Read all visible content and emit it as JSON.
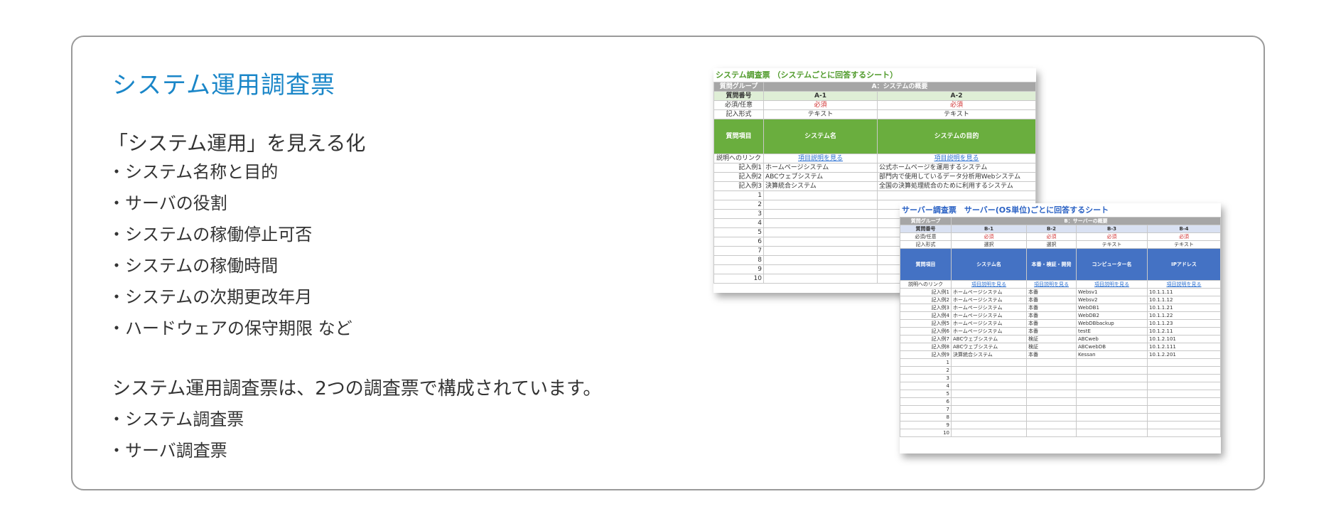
{
  "title": "システム運用調査票",
  "subtitle": "「システム運用」を見える化",
  "features": [
    "システム名称と目的",
    "サーバの役割",
    "システムの稼働停止可否",
    "システムの稼働時間",
    "システムの次期更改年月",
    "ハードウェアの保守期限 など"
  ],
  "description": "システム運用調査票は、2つの調査票で構成されています。",
  "sheets_list": [
    "システム調査票",
    "サーバ調査票"
  ],
  "system_sheet": {
    "title": "システム調査票 （システムごとに回答するシート）",
    "group_label": "質問グループ",
    "group_value": "A：システムの概要",
    "qno_label": "質問番号",
    "qnos": [
      "A-1",
      "A-2"
    ],
    "req_label": "必須/任意",
    "req_values": [
      "必須",
      "必須"
    ],
    "fmt_label": "記入形式",
    "fmt_values": [
      "テキスト",
      "テキスト"
    ],
    "item_label": "質問項目",
    "items": [
      "システム名",
      "システムの目的"
    ],
    "link_label": "説明へのリンク",
    "link_text": "項目説明を見る",
    "examples": [
      {
        "label": "記入例1",
        "values": [
          "ホームページシステム",
          "公式ホームページを運用するシステム"
        ]
      },
      {
        "label": "記入例2",
        "values": [
          "ABCウェブシステム",
          "部門内で使用しているデータ分析用Webシステム"
        ]
      },
      {
        "label": "記入例3",
        "values": [
          "決算統合システム",
          "全国の決算処理統合のために利用するシステム"
        ]
      }
    ],
    "rows": [
      "1",
      "2",
      "3",
      "4",
      "5",
      "6",
      "7",
      "8",
      "9",
      "10"
    ]
  },
  "server_sheet": {
    "title": "サーバー調査票　サーバー(OS単位)ごとに回答するシート",
    "group_label": "質問グループ",
    "group_value": "B：サーバーの概要",
    "qno_label": "質問番号",
    "qnos": [
      "B-1",
      "B-2",
      "B-3",
      "B-4"
    ],
    "req_label": "必須/任意",
    "req_values": [
      "必須",
      "必須",
      "必須",
      "必須"
    ],
    "fmt_label": "記入形式",
    "fmt_values": [
      "選択",
      "選択",
      "テキスト",
      "テキスト"
    ],
    "item_label": "質問項目",
    "items": [
      "システム名",
      "本番・検証・開発",
      "コンピューター名",
      "IPアドレス"
    ],
    "link_label": "説明へのリンク",
    "link_text": "項目説明を見る",
    "examples": [
      {
        "label": "記入例1",
        "values": [
          "ホームページシステム",
          "本番",
          "Websv1",
          "10.1.1.11"
        ]
      },
      {
        "label": "記入例2",
        "values": [
          "ホームページシステム",
          "本番",
          "Websv2",
          "10.1.1.12"
        ]
      },
      {
        "label": "記入例3",
        "values": [
          "ホームページシステム",
          "本番",
          "WebDB1",
          "10.1.1.21"
        ]
      },
      {
        "label": "記入例4",
        "values": [
          "ホームページシステム",
          "本番",
          "WebDB2",
          "10.1.1.22"
        ]
      },
      {
        "label": "記入例5",
        "values": [
          "ホームページシステム",
          "本番",
          "WebDBbackup",
          "10.1.1.23"
        ]
      },
      {
        "label": "記入例6",
        "values": [
          "ホームページシステム",
          "本番",
          "testE",
          "10.1.2.11"
        ]
      },
      {
        "label": "記入例7",
        "values": [
          "ABCウェブシステム",
          "検証",
          "ABCweb",
          "10.1.2.101"
        ]
      },
      {
        "label": "記入例8",
        "values": [
          "ABCウェブシステム",
          "検証",
          "ABCwebDB",
          "10.1.2.111"
        ]
      },
      {
        "label": "記入例9",
        "values": [
          "決算統合システム",
          "本番",
          "Kessan",
          "10.1.2.201"
        ]
      }
    ],
    "rows": [
      "1",
      "2",
      "3",
      "4",
      "5",
      "6",
      "7",
      "8",
      "9",
      "10"
    ]
  },
  "colors": {
    "title": "#1a86c8",
    "green_header": "#6aae3e",
    "blue_header": "#4472c4",
    "border": "#9a9a9a"
  }
}
